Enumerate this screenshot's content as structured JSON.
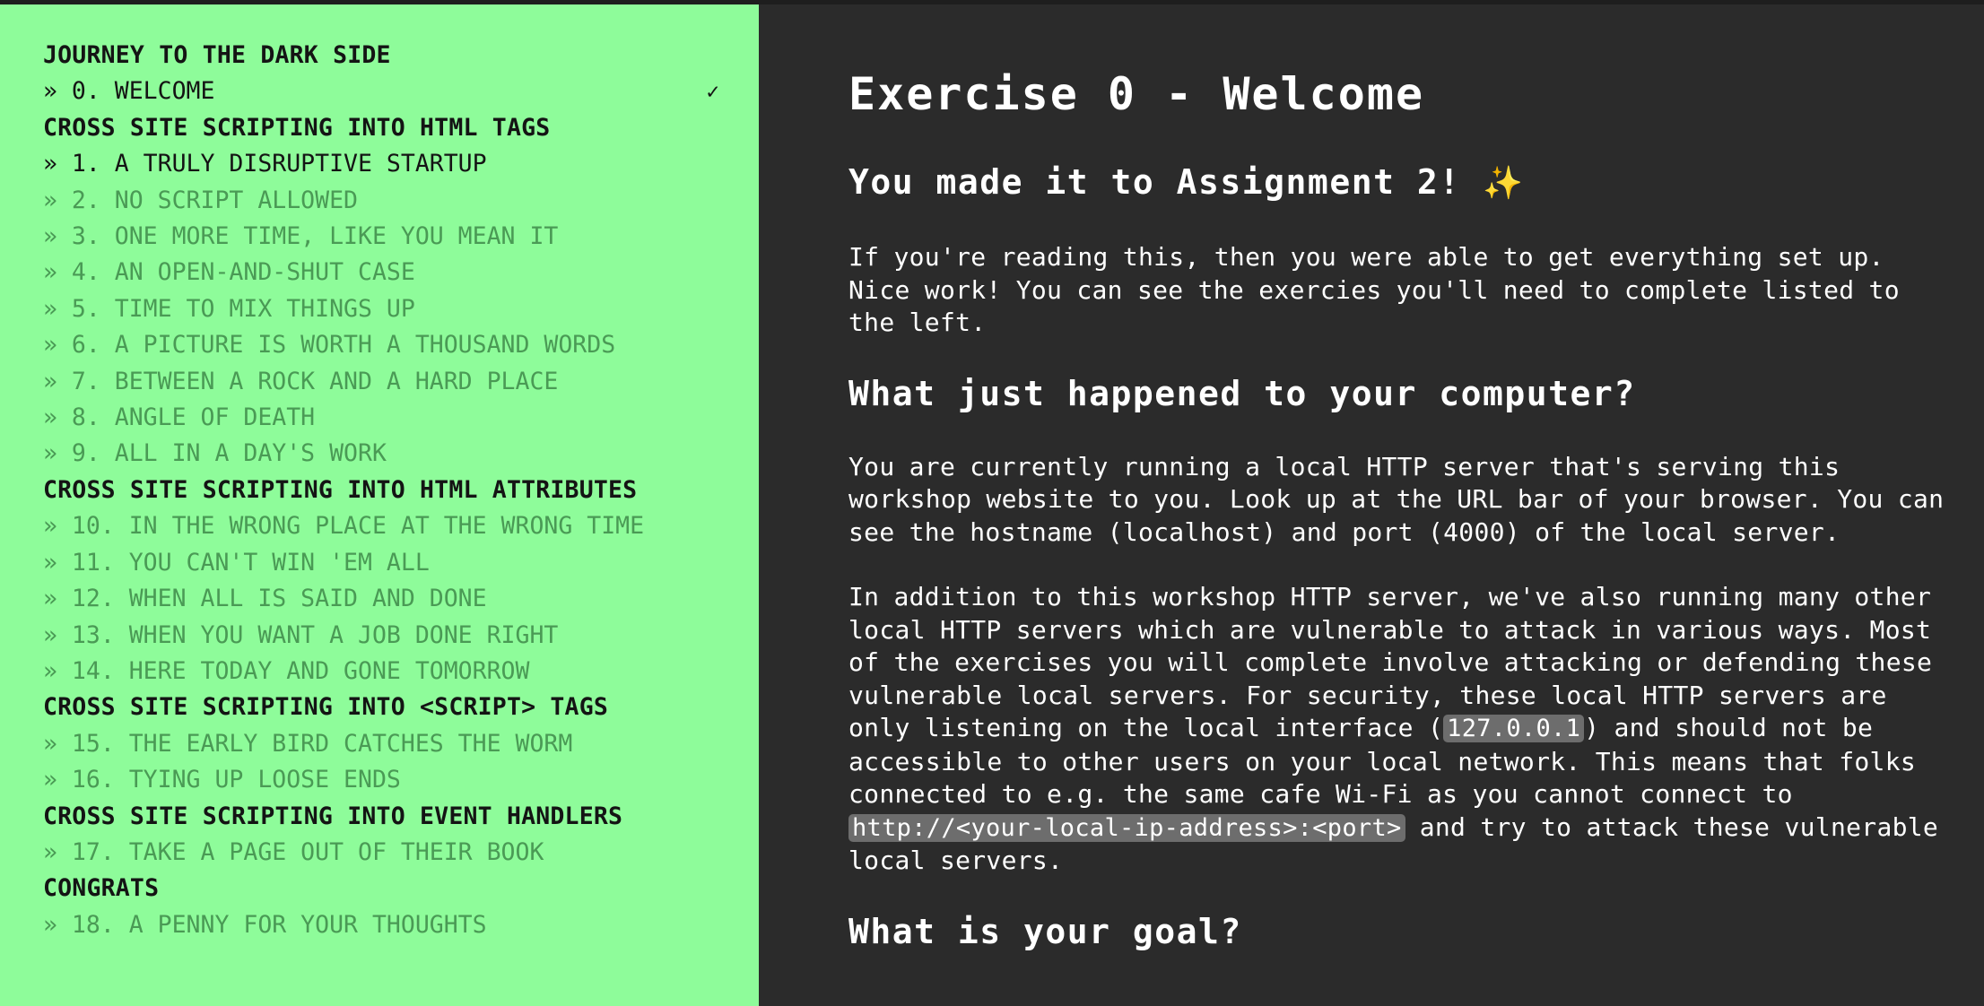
{
  "sidebar": {
    "sections": [
      {
        "title": "JOURNEY TO THE DARK SIDE",
        "items": [
          {
            "label": "» 0. WELCOME",
            "state": "current",
            "check": "✓"
          }
        ]
      },
      {
        "title": "CROSS SITE SCRIPTING INTO HTML TAGS",
        "items": [
          {
            "label": "» 1. A TRULY DISRUPTIVE STARTUP",
            "state": "active"
          },
          {
            "label": "» 2. NO SCRIPT ALLOWED",
            "state": "locked"
          },
          {
            "label": "» 3. ONE MORE TIME, LIKE YOU MEAN IT",
            "state": "locked"
          },
          {
            "label": "» 4. AN OPEN-AND-SHUT CASE",
            "state": "locked"
          },
          {
            "label": "» 5. TIME TO MIX THINGS UP",
            "state": "locked"
          },
          {
            "label": "» 6. A PICTURE IS WORTH A THOUSAND WORDS",
            "state": "locked"
          },
          {
            "label": "» 7. BETWEEN A ROCK AND A HARD PLACE",
            "state": "locked"
          },
          {
            "label": "» 8. ANGLE OF DEATH",
            "state": "locked"
          },
          {
            "label": "» 9. ALL IN A DAY'S WORK",
            "state": "locked"
          }
        ]
      },
      {
        "title": "CROSS SITE SCRIPTING INTO HTML ATTRIBUTES",
        "items": [
          {
            "label": "» 10. IN THE WRONG PLACE AT THE WRONG TIME",
            "state": "locked"
          },
          {
            "label": "» 11. YOU CAN'T WIN 'EM ALL",
            "state": "locked"
          },
          {
            "label": "» 12. WHEN ALL IS SAID AND DONE",
            "state": "locked"
          },
          {
            "label": "» 13. WHEN YOU WANT A JOB DONE RIGHT",
            "state": "locked"
          },
          {
            "label": "» 14. HERE TODAY AND GONE TOMORROW",
            "state": "locked"
          }
        ]
      },
      {
        "title": "CROSS SITE SCRIPTING INTO <SCRIPT> TAGS",
        "items": [
          {
            "label": "» 15. THE EARLY BIRD CATCHES THE WORM",
            "state": "locked"
          },
          {
            "label": "» 16. TYING UP LOOSE ENDS",
            "state": "locked"
          }
        ]
      },
      {
        "title": "CROSS SITE SCRIPTING INTO EVENT HANDLERS",
        "items": [
          {
            "label": "» 17. TAKE A PAGE OUT OF THEIR BOOK",
            "state": "locked"
          }
        ]
      },
      {
        "title": "CONGRATS",
        "items": [
          {
            "label": "» 18. A PENNY FOR YOUR THOUGHTS",
            "state": "locked"
          }
        ]
      }
    ]
  },
  "content": {
    "title": "Exercise 0 - Welcome",
    "subtitle": "You made it to Assignment 2!",
    "subtitle_emoji": "✨",
    "intro_paragraph": "If you're reading this, then you were able to get everything set up. Nice work! You can see the exercies you'll need to complete listed to the left.",
    "section1_heading": "What just happened to your computer?",
    "section1_paragraph": "You are currently running a local HTTP server that's serving this workshop website to you. Look up at the URL bar of your browser. You can see the hostname (localhost) and port (4000) of the local server.",
    "section1_p2_part1": "In addition to this workshop HTTP server, we've also running many other local HTTP servers which are vulnerable to attack in various ways. Most of the exercises you will complete involve attacking or defending these vulnerable local servers. For security, these local HTTP servers are only listening on the local interface (",
    "section1_p2_code1": "127.0.0.1",
    "section1_p2_part2": ") and should not be accessible to other users on your local network. This means that folks connected to e.g. the same cafe Wi-Fi as you cannot connect to ",
    "section1_p2_code2": "http://<your-local-ip-address>:<port>",
    "section1_p2_part3": " and try to attack these vulnerable local servers.",
    "section2_heading": "What is your goal?"
  },
  "colors": {
    "sidebar_bg": "#8efc9a",
    "content_bg": "#2b2b2b",
    "locked_text": "#4a9a55",
    "active_text": "#141414",
    "code_bg": "#6d6d6d"
  }
}
